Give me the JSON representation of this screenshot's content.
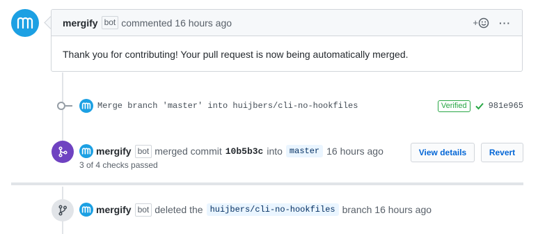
{
  "comment": {
    "author": "mergify",
    "bot_label": "bot",
    "meta": "commented 16 hours ago",
    "add_reaction": "+",
    "more": "···",
    "body": "Thank you for contributing! Your pull request is now being automatically merged."
  },
  "commit": {
    "message": "Merge branch 'master' into huijbers/cli-no-hookfiles",
    "verified": "Verified",
    "sha": "981e965"
  },
  "merged_event": {
    "author": "mergify",
    "bot_label": "bot",
    "text_before": "merged commit",
    "commit": "10b5b3c",
    "text_into": "into",
    "branch": "master",
    "time": "16 hours ago",
    "checks": "3 of 4 checks passed",
    "view_details": "View details",
    "revert": "Revert"
  },
  "deleted_event": {
    "author": "mergify",
    "bot_label": "bot",
    "text_before": "deleted the",
    "branch": "huijbers/cli-no-hookfiles",
    "text_after": "branch 16 hours ago"
  },
  "colors": {
    "avatar": "#1ca0e3",
    "merged_badge": "#6f42c1",
    "verified": "#28a745",
    "link": "#0366d6"
  }
}
